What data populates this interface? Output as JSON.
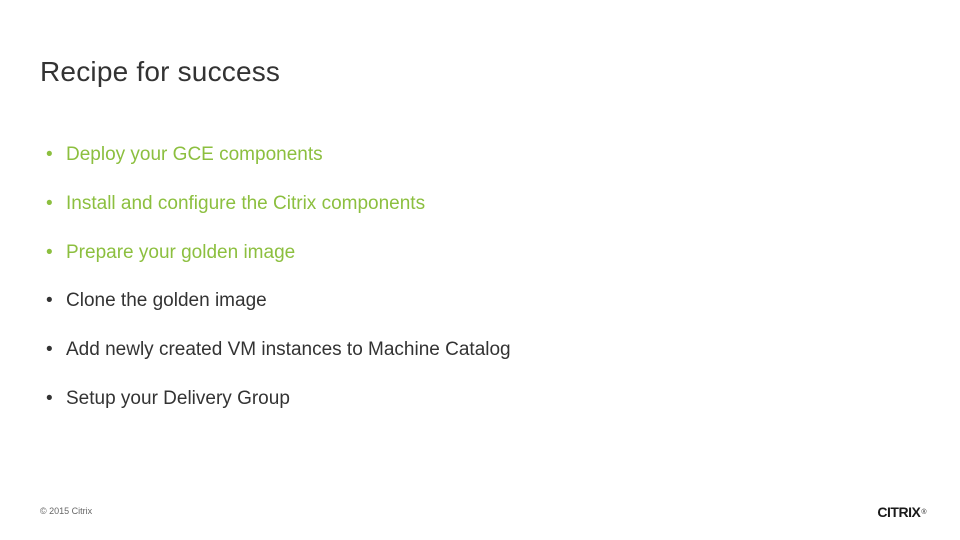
{
  "title": "Recipe for success",
  "bullets": [
    {
      "text": "Deploy your GCE components",
      "accent": true
    },
    {
      "text": "Install and configure the Citrix components",
      "accent": true
    },
    {
      "text": "Prepare your golden image",
      "accent": true
    },
    {
      "text": "Clone the golden image",
      "accent": false
    },
    {
      "text": "Add newly created VM instances to Machine Catalog",
      "accent": false
    },
    {
      "text": "Setup your Delivery Group",
      "accent": false
    }
  ],
  "footer": "© 2015 Citrix",
  "logo": {
    "c1": "C",
    "i1": "I",
    "t": "TR",
    "i2": "I",
    "x": "X",
    "reg": "®"
  }
}
